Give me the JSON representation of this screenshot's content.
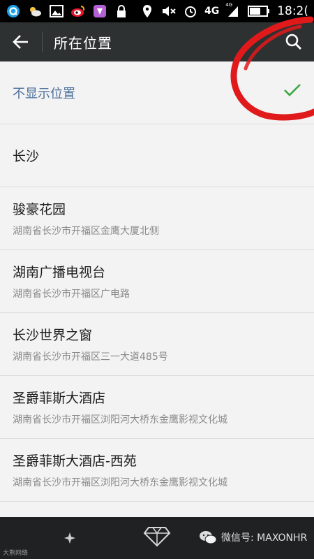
{
  "status_bar": {
    "network": "4G",
    "network_small": "4G",
    "time": "18:2("
  },
  "header": {
    "title": "所在位置",
    "back_icon": "arrow-left-icon",
    "search_icon": "search-icon"
  },
  "list": {
    "items": [
      {
        "name": "不显示位置",
        "address": "",
        "selected": true
      },
      {
        "name": "长沙",
        "address": ""
      },
      {
        "name": "骏豪花园",
        "address": "湖南省长沙市开福区金鹰大厦北侧"
      },
      {
        "name": "湖南广播电视台",
        "address": "湖南省长沙市开福区广电路"
      },
      {
        "name": "长沙世界之窗",
        "address": "湖南省长沙市开福区三一大道485号"
      },
      {
        "name": "圣爵菲斯大酒店",
        "address": "湖南省长沙市开福区浏阳河大桥东金鹰影视文化城"
      },
      {
        "name": "圣爵菲斯大酒店-西苑",
        "address": "湖南省长沙市开福区浏阳河大桥东金鹰影视文化城"
      }
    ]
  },
  "bottom_bar": {
    "wechat_text": "微信号: MAXONHR",
    "small_text": "大熊网络"
  },
  "colors": {
    "header_bg": "#2e3132",
    "check_green": "#3aa845",
    "annotation_red": "#e0191b"
  }
}
